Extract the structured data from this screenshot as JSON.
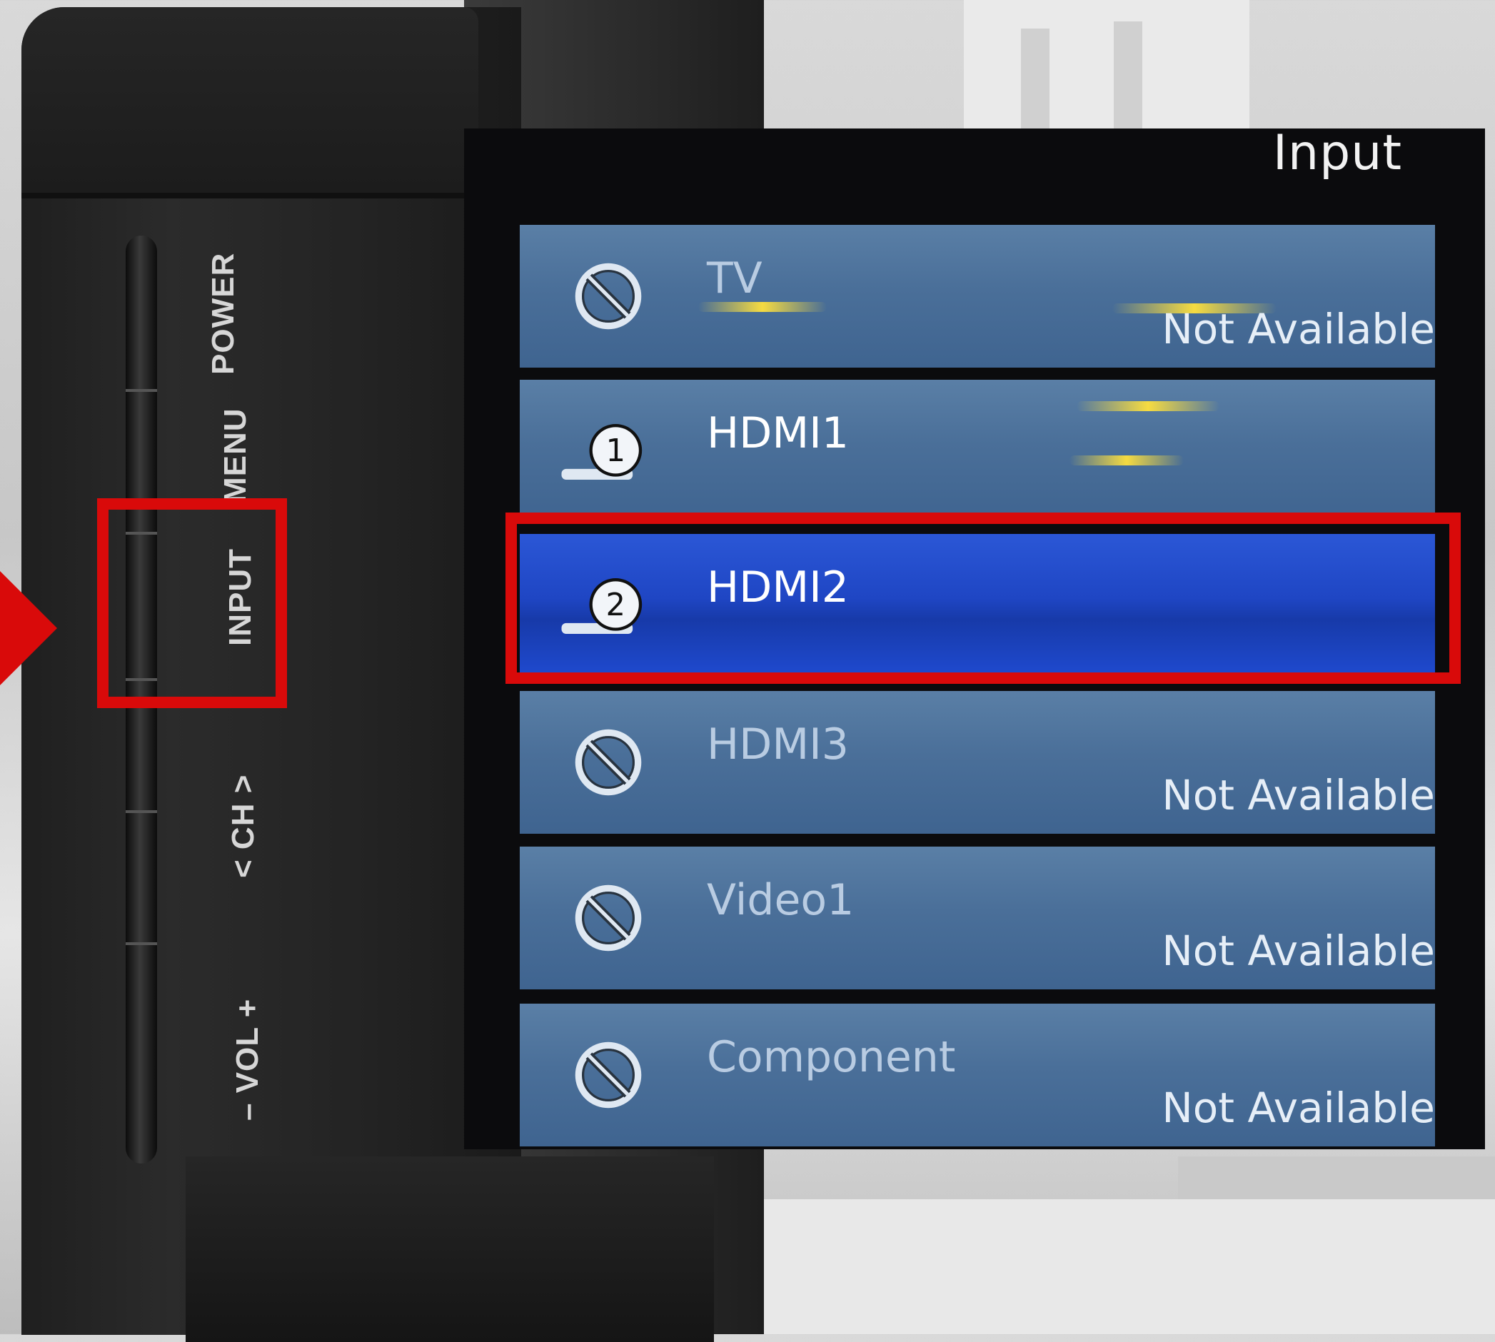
{
  "side_panel": {
    "buttons": [
      {
        "label": "POWER"
      },
      {
        "label": "MENU"
      },
      {
        "label": "INPUT"
      },
      {
        "label": "< CH >"
      },
      {
        "label": "– VOL +"
      }
    ]
  },
  "menu": {
    "title": "Input",
    "items": [
      {
        "label": "TV",
        "status": "Not Available",
        "icon": "no-entry-icon"
      },
      {
        "label": "HDMI1",
        "status": "",
        "icon": "hdmi-1-icon",
        "number": "1"
      },
      {
        "label": "HDMI2",
        "status": "",
        "icon": "hdmi-2-icon",
        "number": "2",
        "selected": true
      },
      {
        "label": "HDMI3",
        "status": "Not Available",
        "icon": "no-entry-icon"
      },
      {
        "label": "Video1",
        "status": "Not Available",
        "icon": "no-entry-icon"
      },
      {
        "label": "Component",
        "status": "Not Available",
        "icon": "no-entry-icon"
      }
    ]
  },
  "colors": {
    "highlight": "#d90a0a",
    "item_bg": "#4a6f99",
    "selected_bg": "#1f46c4"
  }
}
